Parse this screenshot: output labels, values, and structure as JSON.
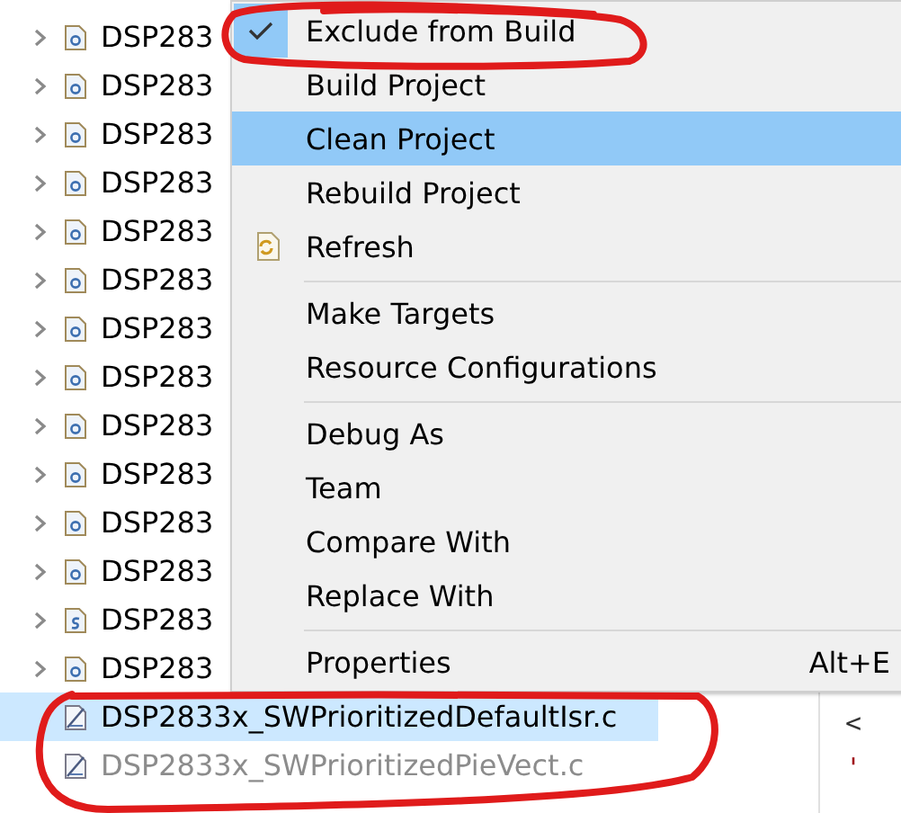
{
  "tree": {
    "items": [
      {
        "label": "DSP283",
        "kind": "c",
        "selected": false,
        "greyed": false
      },
      {
        "label": "DSP283",
        "kind": "c",
        "selected": false,
        "greyed": false
      },
      {
        "label": "DSP283",
        "kind": "c",
        "selected": false,
        "greyed": false
      },
      {
        "label": "DSP283",
        "kind": "c",
        "selected": false,
        "greyed": false
      },
      {
        "label": "DSP283",
        "kind": "c",
        "selected": false,
        "greyed": false
      },
      {
        "label": "DSP283",
        "kind": "c",
        "selected": false,
        "greyed": false
      },
      {
        "label": "DSP283",
        "kind": "c",
        "selected": false,
        "greyed": false
      },
      {
        "label": "DSP283",
        "kind": "c",
        "selected": false,
        "greyed": false
      },
      {
        "label": "DSP283",
        "kind": "c",
        "selected": false,
        "greyed": false
      },
      {
        "label": "DSP283",
        "kind": "c",
        "selected": false,
        "greyed": false
      },
      {
        "label": "DSP283",
        "kind": "c",
        "selected": false,
        "greyed": false
      },
      {
        "label": "DSP283",
        "kind": "c",
        "selected": false,
        "greyed": false
      },
      {
        "label": "DSP283",
        "kind": "asm",
        "selected": false,
        "greyed": false
      },
      {
        "label": "DSP283",
        "kind": "c",
        "selected": false,
        "greyed": false
      },
      {
        "label": "DSP2833x_SWPrioritizedDefaultIsr.c",
        "kind": "excluded",
        "selected": true,
        "greyed": false
      },
      {
        "label": "DSP2833x_SWPrioritizedPieVect.c",
        "kind": "excluded",
        "selected": false,
        "greyed": true
      }
    ]
  },
  "context_menu": {
    "items": [
      {
        "kind": "item",
        "label": "Exclude from Build",
        "checked": true,
        "selected": false
      },
      {
        "kind": "item",
        "label": "Build Project",
        "checked": false,
        "selected": false
      },
      {
        "kind": "item",
        "label": "Clean Project",
        "checked": false,
        "selected": true
      },
      {
        "kind": "item",
        "label": "Rebuild Project",
        "checked": false,
        "selected": false
      },
      {
        "kind": "refresh",
        "label": "Refresh",
        "checked": false,
        "selected": false
      },
      {
        "kind": "separator"
      },
      {
        "kind": "item",
        "label": "Make Targets",
        "checked": false,
        "selected": false
      },
      {
        "kind": "item",
        "label": "Resource Configurations",
        "checked": false,
        "selected": false
      },
      {
        "kind": "separator"
      },
      {
        "kind": "item",
        "label": "Debug As",
        "checked": false,
        "selected": false
      },
      {
        "kind": "item",
        "label": "Team",
        "checked": false,
        "selected": false
      },
      {
        "kind": "item",
        "label": "Compare With",
        "checked": false,
        "selected": false
      },
      {
        "kind": "item",
        "label": "Replace With",
        "checked": false,
        "selected": false
      },
      {
        "kind": "separator"
      },
      {
        "kind": "item",
        "label": "Properties",
        "shortcut": "Alt+E",
        "checked": false,
        "selected": false
      }
    ]
  },
  "editor": {
    "lines": [
      "<",
      "'"
    ]
  }
}
